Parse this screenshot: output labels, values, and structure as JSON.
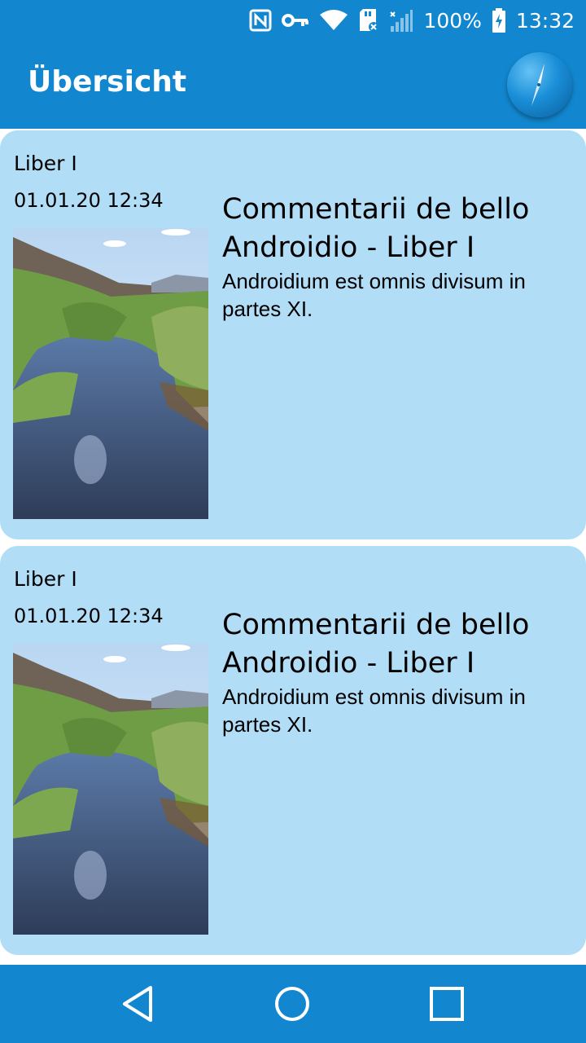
{
  "status_bar": {
    "icons": [
      "nfc-icon",
      "vpn-key-icon",
      "wifi-icon",
      "sd-card-icon",
      "cell-signal-icon",
      "battery-charging-icon"
    ],
    "battery": "100%",
    "time": "13:32"
  },
  "app_bar": {
    "title": "Übersicht",
    "action_icon": "compass-icon"
  },
  "articles": [
    {
      "category": "Liber I",
      "date": "01.01.20 12:34",
      "title": "Commentarii de bello Androidio - Liber I",
      "text": "Androidium est omnis divisum in partes XI.",
      "image": "river-landscape"
    },
    {
      "category": "Liber I",
      "date": "01.01.20 12:34",
      "title": "Commentarii de bello Androidio - Liber I",
      "text": "Androidium est omnis divisum in partes XI.",
      "image": "river-landscape"
    }
  ],
  "nav_bar": {
    "buttons": [
      "back-icon",
      "home-icon",
      "recents-icon"
    ]
  },
  "colors": {
    "primary": "#1287cf",
    "card_background": "#b1ddf6"
  }
}
